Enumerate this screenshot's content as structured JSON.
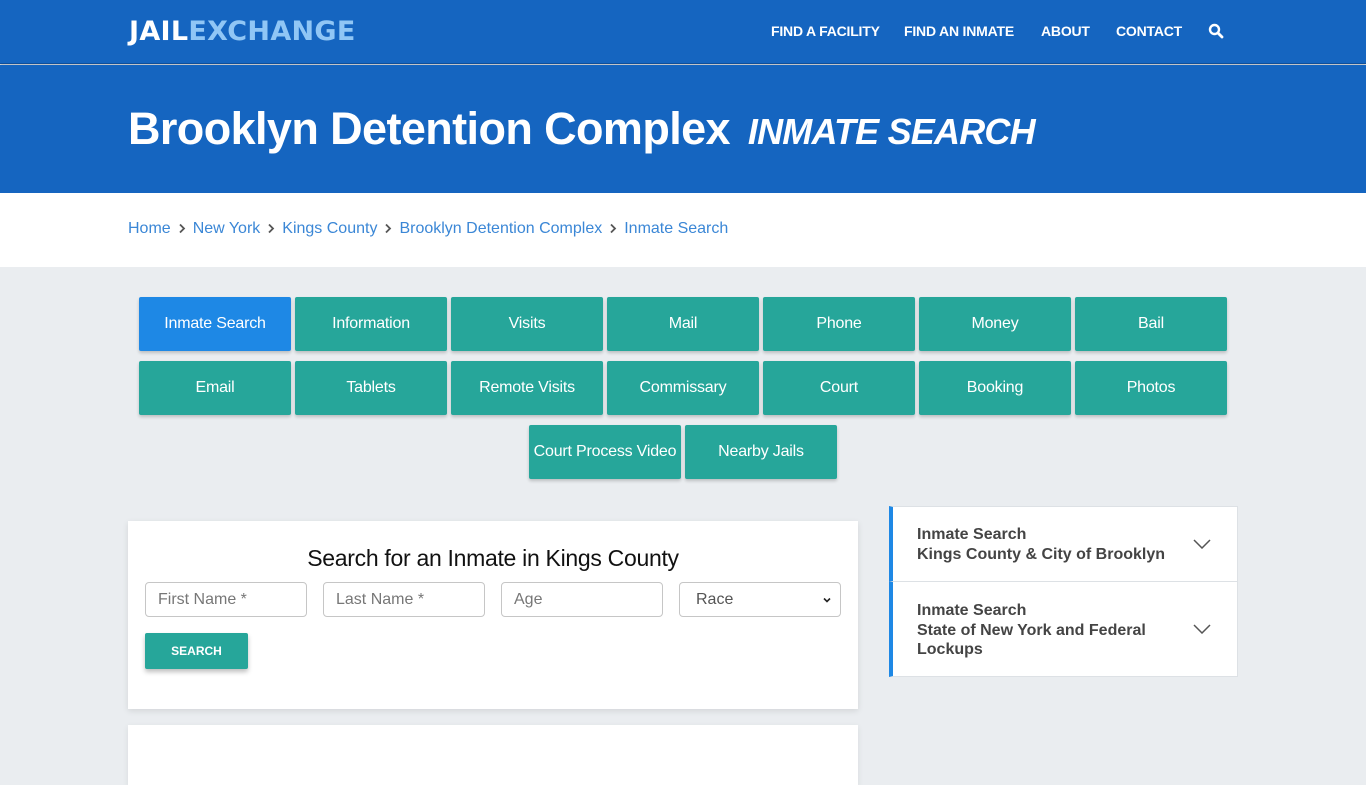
{
  "brand": {
    "part1": "JAIL",
    "part2": "EXCHANGE"
  },
  "nav": {
    "items": [
      "FIND A FACILITY",
      "FIND AN INMATE",
      "ABOUT",
      "CONTACT"
    ],
    "search_icon": "search-icon"
  },
  "hero": {
    "title": "Brooklyn Detention Complex",
    "subtitle": "INMATE SEARCH"
  },
  "breadcrumb": [
    "Home",
    "New York",
    "Kings County",
    "Brooklyn Detention Complex",
    "Inmate Search"
  ],
  "tabs": {
    "row1": [
      "Inmate Search",
      "Information",
      "Visits",
      "Mail",
      "Phone",
      "Money",
      "Bail"
    ],
    "row2": [
      "Email",
      "Tablets",
      "Remote Visits",
      "Commissary",
      "Court",
      "Booking",
      "Photos"
    ],
    "row3": [
      "Court Process Video",
      "Nearby Jails"
    ],
    "active": "Inmate Search"
  },
  "search_form": {
    "heading": "Search for an Inmate in Kings County",
    "first_name_placeholder": "First Name *",
    "last_name_placeholder": "Last Name *",
    "age_placeholder": "Age",
    "race_selected": "Race",
    "submit_label": "SEARCH"
  },
  "sidebar": {
    "items": [
      {
        "line1": "Inmate Search",
        "line2": "Kings County & City of Brooklyn"
      },
      {
        "line1": "Inmate Search",
        "line2": "State of New York and Federal",
        "line3": "Lockups"
      }
    ]
  },
  "colors": {
    "primary_blue": "#1565c0",
    "accent_blue": "#1e88e5",
    "teal": "#26a69a",
    "logo_light": "#90c6f5",
    "link": "#3b87d6",
    "page_bg": "#eaedf0"
  }
}
